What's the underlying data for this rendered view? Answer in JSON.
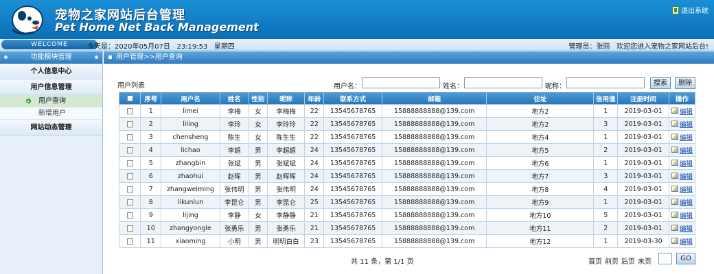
{
  "header": {
    "title_cn": "宠物之家网站后台管理",
    "title_en": "Pet Home Net Back Management",
    "logout_label": "退出系统"
  },
  "status": {
    "welcome": "WELCOME",
    "date_label": "今天是：",
    "date": "2020年05月07日",
    "time": "23:19:53",
    "weekday": "星期四",
    "admin_label": "管理员：",
    "admin_name": "张丽",
    "greeting": "欢迎您进入宠物之家网站后台!"
  },
  "sidebar": {
    "head": "功能模块管理",
    "groups": [
      {
        "label": "个人信息中心"
      },
      {
        "label": "用户信息管理",
        "items": [
          {
            "label": "用户查询"
          },
          {
            "label": "新增用户"
          }
        ]
      },
      {
        "label": "网站动态管理"
      }
    ]
  },
  "main": {
    "breadcrumb": "用户管理>>用户查询",
    "list_title": "用户列表",
    "search": {
      "username_label": "用户名：",
      "name_label": "姓名：",
      "nickname_label": "昵称：",
      "username_value": "",
      "name_value": "",
      "nickname_value": "",
      "search_btn": "搜索",
      "delete_btn": "删除"
    },
    "columns": [
      "",
      "序号",
      "用户名",
      "姓名",
      "性别",
      "昵称",
      "年龄",
      "联系方式",
      "邮箱",
      "住址",
      "信用值",
      "注册时间",
      "操作"
    ],
    "rows": [
      [
        "1",
        "limei",
        "李梅",
        "女",
        "李梅梅",
        "22",
        "13545678765",
        "15888888888@139.com",
        "地方2",
        "1",
        "2019-03-01"
      ],
      [
        "2",
        "liling",
        "李玲",
        "女",
        "李玲玲",
        "22",
        "13545678765",
        "15888888888@139.com",
        "地方2",
        "3",
        "2019-03-01"
      ],
      [
        "3",
        "chensheng",
        "陈生",
        "女",
        "陈生生",
        "22",
        "13545678765",
        "15888888888@139.com",
        "地方4",
        "1",
        "2019-03-01"
      ],
      [
        "4",
        "lichao",
        "李超",
        "男",
        "李超超",
        "24",
        "13545678765",
        "15888888888@139.com",
        "地方5",
        "2",
        "2019-03-01"
      ],
      [
        "5",
        "zhangbin",
        "张斌",
        "男",
        "张斌斌",
        "24",
        "13545678765",
        "15888888888@139.com",
        "地方6",
        "1",
        "2019-03-01"
      ],
      [
        "6",
        "zhaohui",
        "赵晖",
        "男",
        "赵晖晖",
        "24",
        "13545678765",
        "15888888888@139.com",
        "地方7",
        "3",
        "2019-03-01"
      ],
      [
        "7",
        "zhangweiming",
        "张伟明",
        "男",
        "张伟明",
        "24",
        "13545678765",
        "15888888888@139.com",
        "地方8",
        "4",
        "2019-03-01"
      ],
      [
        "8",
        "likunlun",
        "李昆仑",
        "男",
        "李昆仑",
        "25",
        "13545678765",
        "15888888888@139.com",
        "地方9",
        "1",
        "2019-03-01"
      ],
      [
        "9",
        "lijing",
        "李静",
        "女",
        "李静静",
        "21",
        "13545678765",
        "15888888888@139.com",
        "地方10",
        "5",
        "2019-03-01"
      ],
      [
        "10",
        "zhangyongle",
        "张勇乐",
        "男",
        "张勇乐",
        "21",
        "13545678765",
        "15888888888@139.com",
        "地方11",
        "2",
        "2019-03-01"
      ],
      [
        "11",
        "xiaoming",
        "小明",
        "男",
        "明明白白",
        "23",
        "13545678765",
        "15888888888@139.com",
        "地方12",
        "1",
        "2019-03-30"
      ]
    ],
    "edit_label": "编辑",
    "pager": {
      "summary": "共 11 条，第 1/1 页",
      "first": "首页",
      "prev": "前页",
      "next": "后页",
      "last": "末页",
      "page_value": "",
      "go": "GO"
    }
  }
}
